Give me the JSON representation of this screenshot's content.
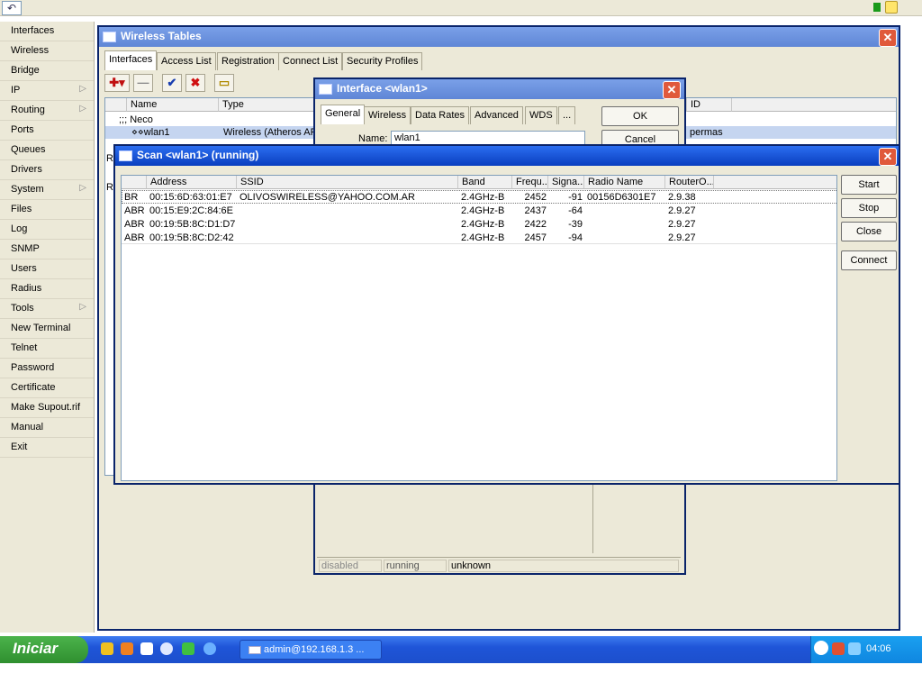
{
  "left_menu": {
    "items": [
      {
        "label": "Interfaces",
        "submenu": false
      },
      {
        "label": "Wireless",
        "submenu": false
      },
      {
        "label": "Bridge",
        "submenu": false
      },
      {
        "label": "IP",
        "submenu": true
      },
      {
        "label": "Routing",
        "submenu": true
      },
      {
        "label": "Ports",
        "submenu": false
      },
      {
        "label": "Queues",
        "submenu": false
      },
      {
        "label": "Drivers",
        "submenu": false
      },
      {
        "label": "System",
        "submenu": true
      },
      {
        "label": "Files",
        "submenu": false
      },
      {
        "label": "Log",
        "submenu": false
      },
      {
        "label": "SNMP",
        "submenu": false
      },
      {
        "label": "Users",
        "submenu": false
      },
      {
        "label": "Radius",
        "submenu": false
      },
      {
        "label": "Tools",
        "submenu": true
      },
      {
        "label": "New Terminal",
        "submenu": false
      },
      {
        "label": "Telnet",
        "submenu": false
      },
      {
        "label": "Password",
        "submenu": false
      },
      {
        "label": "Certificate",
        "submenu": false
      },
      {
        "label": "Make Supout.rif",
        "submenu": false
      },
      {
        "label": "Manual",
        "submenu": false
      },
      {
        "label": "Exit",
        "submenu": false
      }
    ]
  },
  "wireless_tables": {
    "title": "Wireless Tables",
    "close": "✕",
    "tabs": [
      "Interfaces",
      "Access List",
      "Registration",
      "Connect List",
      "Security Profiles"
    ],
    "columns": {
      "name": "Name",
      "type": "Type",
      "id": "ID"
    },
    "rows": [
      {
        "name": ";;; Neco",
        "type": "",
        "id": ""
      },
      {
        "name": "⋄⋄wlan1",
        "type": "Wireless (Atheros AR5",
        "id": "permas"
      }
    ],
    "side_labels": [
      "R",
      "R"
    ]
  },
  "interface_dialog": {
    "title": "Interface <wlan1>",
    "close": "✕",
    "tabs": [
      "General",
      "Wireless",
      "Data Rates",
      "Advanced",
      "WDS",
      "..."
    ],
    "name_label": "Name:",
    "name_value": "wlan1",
    "ok_label": "OK",
    "cancel_label": "Cancel",
    "status": [
      "disabled",
      "running",
      "unknown"
    ]
  },
  "scan_window": {
    "title": "Scan <wlan1> (running)",
    "close": "✕",
    "columns": {
      "flags": "",
      "address": "Address",
      "ssid": "SSID",
      "band": "Band",
      "freq": "Frequ...",
      "signal": "Signa...",
      "radio_name": "Radio Name",
      "router_os": "RouterO..."
    },
    "rows": [
      {
        "flags": "BR",
        "address": "00:15:6D:63:01:E7",
        "ssid": "OLIVOSWIRELESS@YAHOO.COM.AR",
        "band": "2.4GHz-B",
        "freq": "2452",
        "signal": "-91",
        "radio_name": "00156D6301E7",
        "router_os": "2.9.38"
      },
      {
        "flags": "ABR",
        "address": "00:15:E9:2C:84:6E",
        "ssid": "",
        "band": "2.4GHz-B",
        "freq": "2437",
        "signal": "-64",
        "radio_name": "",
        "router_os": "2.9.27"
      },
      {
        "flags": "ABR",
        "address": "00:19:5B:8C:D1:D7",
        "ssid": "",
        "band": "2.4GHz-B",
        "freq": "2422",
        "signal": "-39",
        "radio_name": "",
        "router_os": "2.9.27"
      },
      {
        "flags": "ABR",
        "address": "00:19:5B:8C:D2:42",
        "ssid": "",
        "band": "2.4GHz-B",
        "freq": "2457",
        "signal": "-94",
        "radio_name": "",
        "router_os": "2.9.27"
      }
    ],
    "buttons": {
      "start": "Start",
      "stop": "Stop",
      "close": "Close",
      "connect": "Connect"
    }
  },
  "toolbar": {
    "undo_icon": "↶"
  },
  "taskbar": {
    "start_label": "Iniciar",
    "task_label": "admin@192.168.1.3 ...",
    "clock": "04:06"
  }
}
